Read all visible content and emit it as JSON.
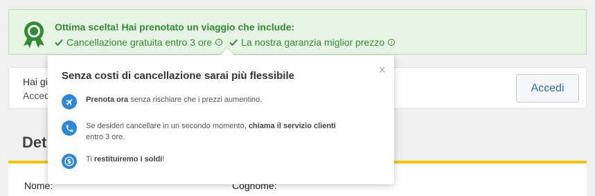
{
  "banner": {
    "headline": "Ottima scelta! Hai prenotato un viaggio che include:",
    "features": [
      {
        "label": "Cancellazione gratuita entro 3 ore",
        "info_glyph": "i"
      },
      {
        "label": "La nostra garanzia miglior prezzo",
        "info_glyph": "i"
      }
    ],
    "icons": {
      "badge": "award-ribbon-icon",
      "check": "check-icon",
      "info": "info-icon"
    },
    "color": "#2f8c2f"
  },
  "login": {
    "line1": "Hai gi",
    "line2": "Acced",
    "button_label": "Accedi"
  },
  "section": {
    "title": "Det",
    "fields": {
      "first": "Nome:",
      "last": "Cognome:"
    }
  },
  "popover": {
    "title": "Senza costi di cancellazione sarai più flessibile",
    "close_glyph": "×",
    "items": [
      {
        "icon": "airplane-icon",
        "bold": "Prenota ora",
        "text": " senza rischiare che i prezzi aumentino."
      },
      {
        "icon": "phone-icon",
        "pre": "Se desideri cancellare in un secondo momento, ",
        "bold": "chiama il servizio clienti",
        "text": " entro 3 ore."
      },
      {
        "icon": "money-icon",
        "pre": "Ti ",
        "bold": "restituiremo i soldi",
        "text": "!"
      }
    ],
    "accent": "#2b87d9"
  }
}
